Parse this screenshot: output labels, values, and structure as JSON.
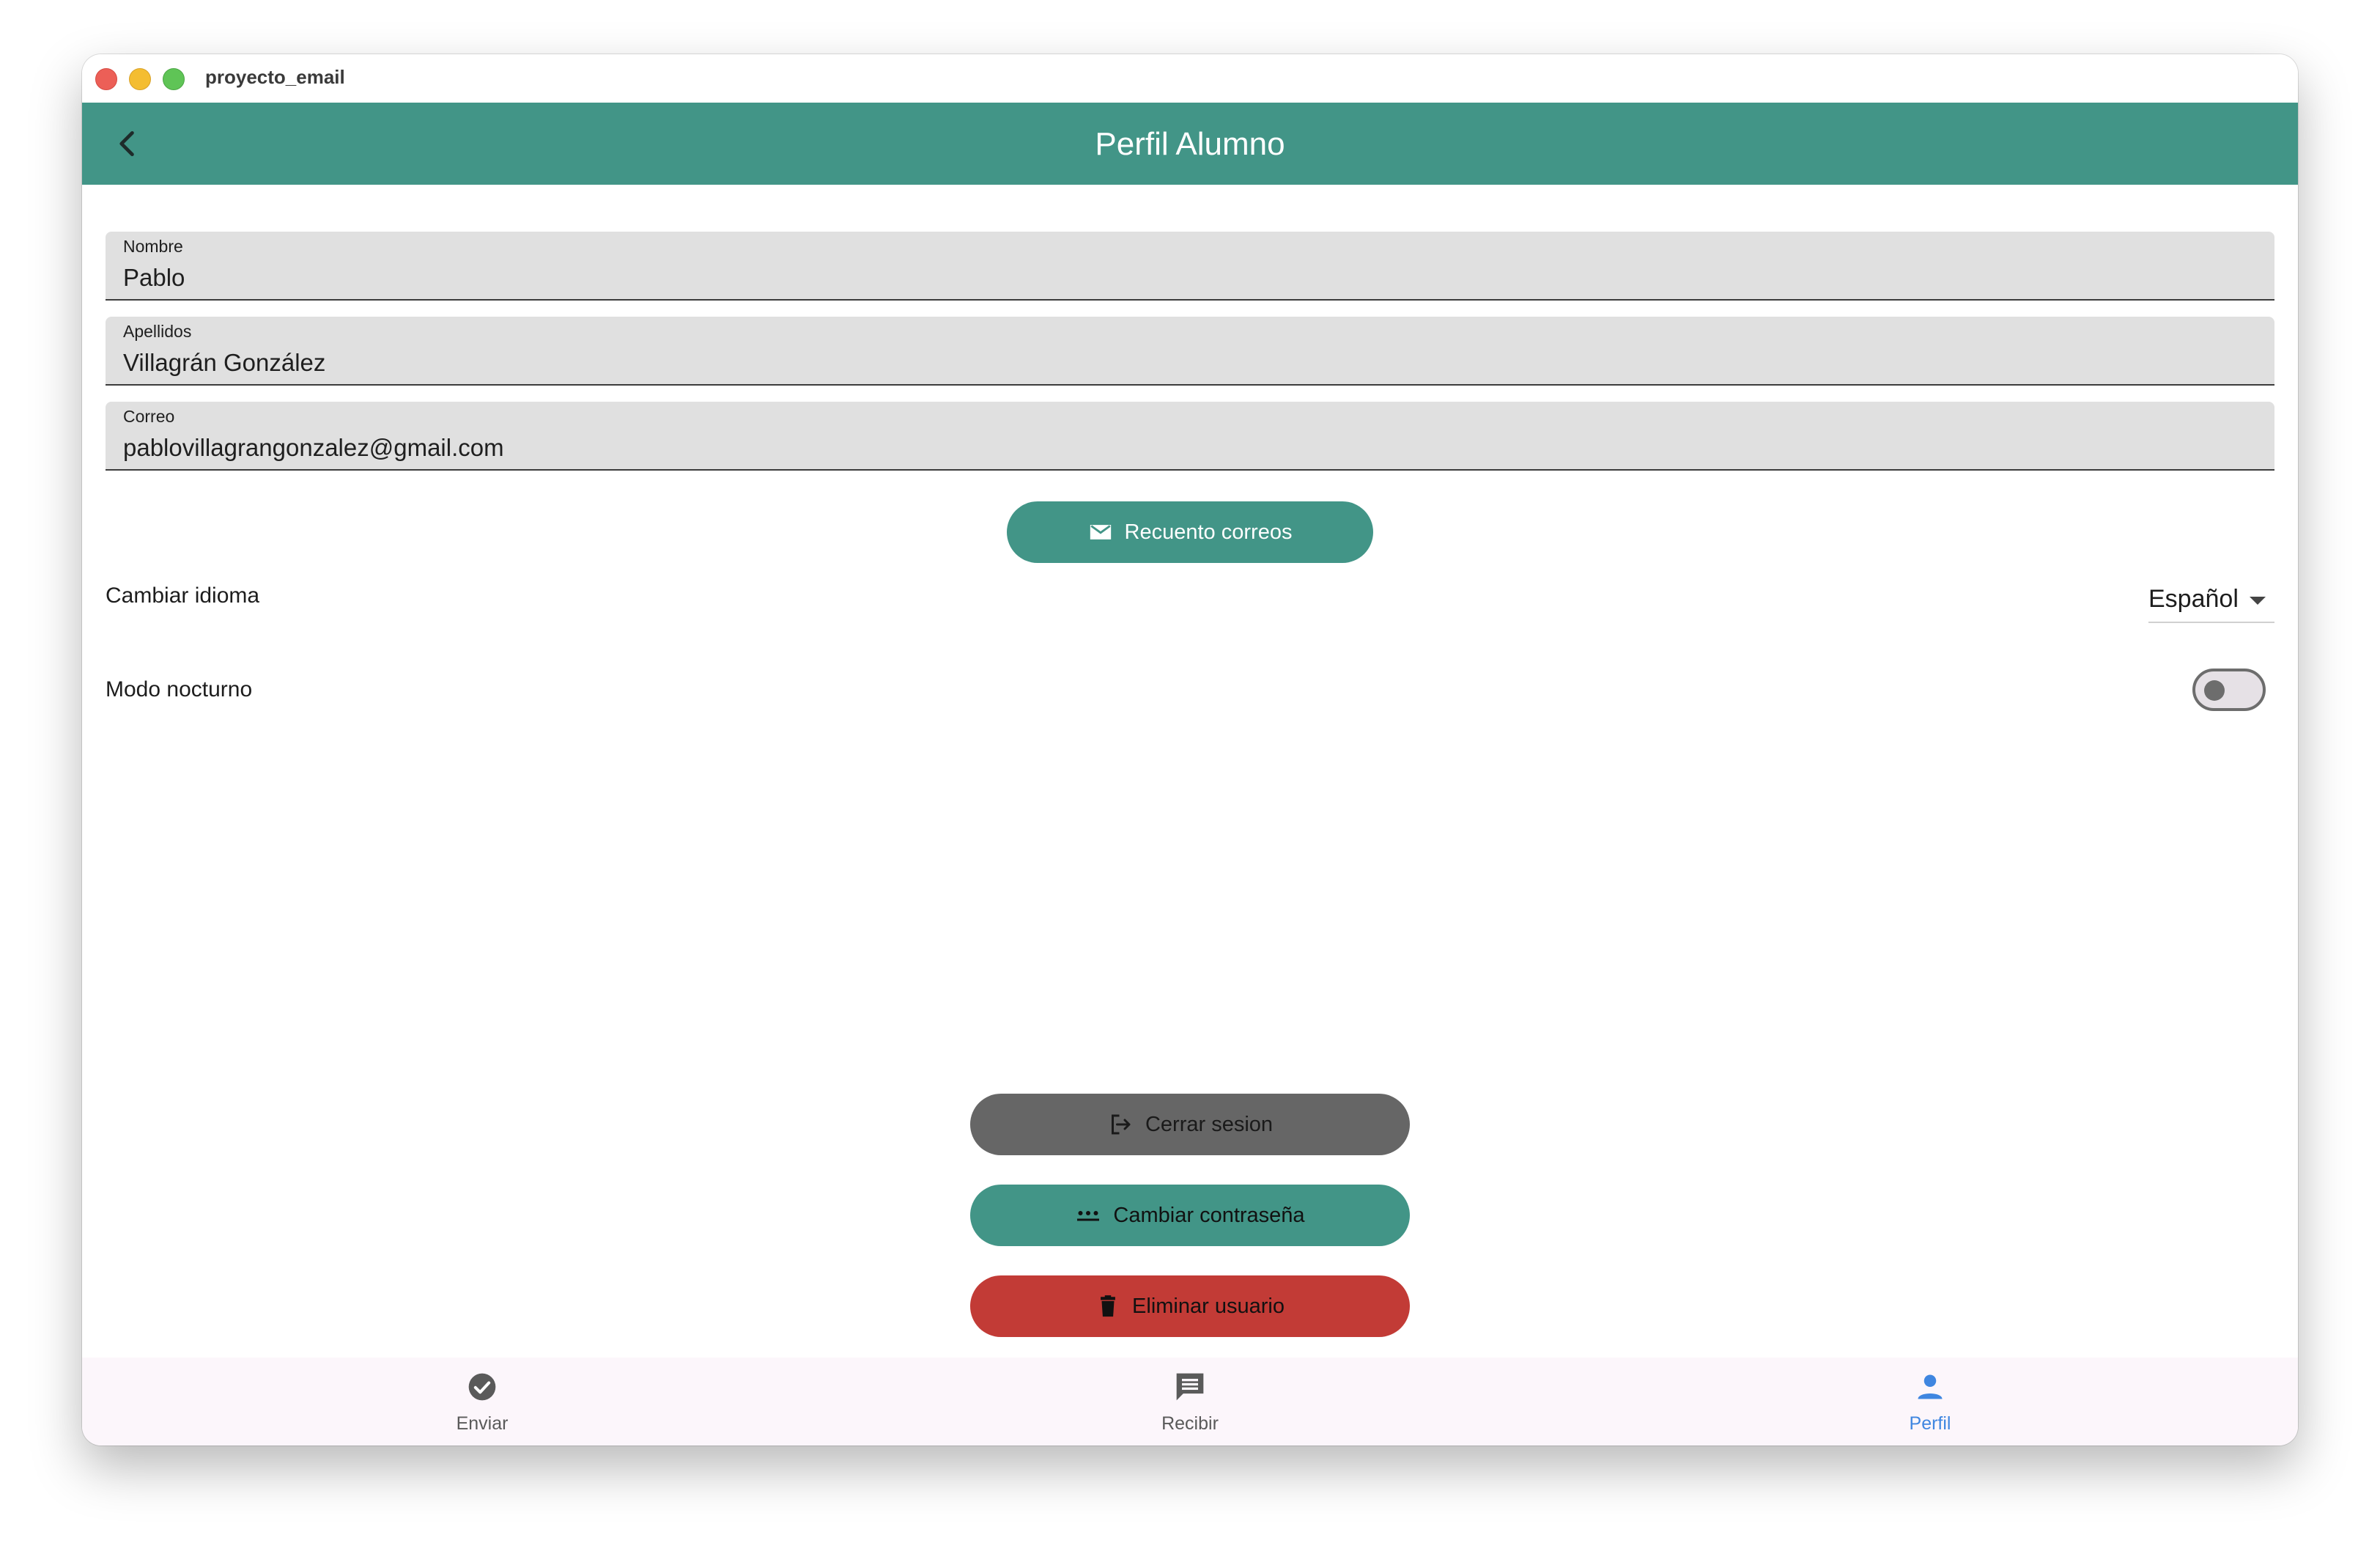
{
  "window": {
    "title": "proyecto_email"
  },
  "appbar": {
    "title": "Perfil Alumno",
    "back_icon": "arrow-back-icon"
  },
  "fields": [
    {
      "label": "Nombre",
      "value": "Pablo"
    },
    {
      "label": "Apellidos",
      "value": "Villagrán González"
    },
    {
      "label": "Correo",
      "value": "pablovillagrangonzalez@gmail.com"
    }
  ],
  "buttons": {
    "count_emails": {
      "label": "Recuento correos",
      "icon": "mail-icon"
    },
    "logout": {
      "label": "Cerrar sesion",
      "icon": "logout-icon"
    },
    "change_password": {
      "label": "Cambiar contraseña",
      "icon": "password-icon"
    },
    "delete_user": {
      "label": "Eliminar usuario",
      "icon": "trash-icon"
    }
  },
  "settings": {
    "language": {
      "label": "Cambiar idioma",
      "value": "Español"
    },
    "night_mode": {
      "label": "Modo nocturno",
      "enabled": false
    }
  },
  "bottom_nav": [
    {
      "label": "Enviar",
      "icon": "check-circle-icon",
      "active": false
    },
    {
      "label": "Recibir",
      "icon": "chat-icon",
      "active": false
    },
    {
      "label": "Perfil",
      "icon": "person-icon",
      "active": true
    }
  ],
  "colors": {
    "primary": "#429587",
    "danger": "#c23b36",
    "neutral_button": "#666666",
    "nav_active": "#3f86e0",
    "nav_inactive": "#5a5a5a"
  }
}
